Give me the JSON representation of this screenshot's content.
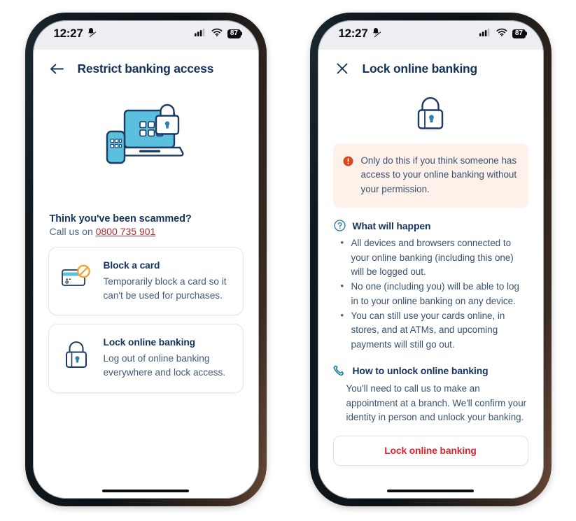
{
  "status_bar": {
    "time": "12:27",
    "notification_icon": "bell-muted-icon",
    "signal_icon": "cellular-signal-icon",
    "wifi_icon": "wifi-icon",
    "battery_level": "87"
  },
  "colors": {
    "navy": "#14325d",
    "body_blue": "#39516f",
    "accent_red": "#d9232e",
    "link_red": "#b02a37",
    "alert_orange": "#d94e1d",
    "alert_bg": "#fdf1ea",
    "teal": "#2b7fa8",
    "illustration_blue": "#5bc0de",
    "card_border": "#e3e6ea"
  },
  "screen_one": {
    "back_icon": "back-arrow-icon",
    "title": "Restrict banking access",
    "illustration_name": "devices-lock-illustration",
    "scam": {
      "heading": "Think you've been scammed?",
      "call_prefix": "Call us on ",
      "phone_number": "0800 735 901"
    },
    "options": [
      {
        "icon": "blocked-card-icon",
        "title": "Block a card",
        "description": "Temporarily block a card so it can't be used for purchases."
      },
      {
        "icon": "padlock-icon",
        "title": "Lock online banking",
        "description": "Log out of online banking everywhere and lock access."
      }
    ]
  },
  "screen_two": {
    "close_icon": "close-icon",
    "title": "Lock online banking",
    "hero_icon": "padlock-icon",
    "alert": {
      "icon": "alert-exclamation-icon",
      "text": "Only do this if you think someone has access to your online banking without your permission."
    },
    "what_will_happen": {
      "icon": "question-circle-icon",
      "title": "What will happen",
      "bullets": [
        "All devices and browsers connected to your online banking (including this one) will be logged out.",
        "No one (including you) will be able to log in to your online banking on any device.",
        "You can still use your cards online, in stores, and at ATMs, and upcoming payments will still go out."
      ]
    },
    "how_to_unlock": {
      "icon": "phone-handset-icon",
      "title": "How to unlock online banking",
      "paragraph": "You'll need to call us to make an appointment at a branch. We'll confirm your identity in person and unlock your banking."
    },
    "cta_label": "Lock online banking"
  }
}
